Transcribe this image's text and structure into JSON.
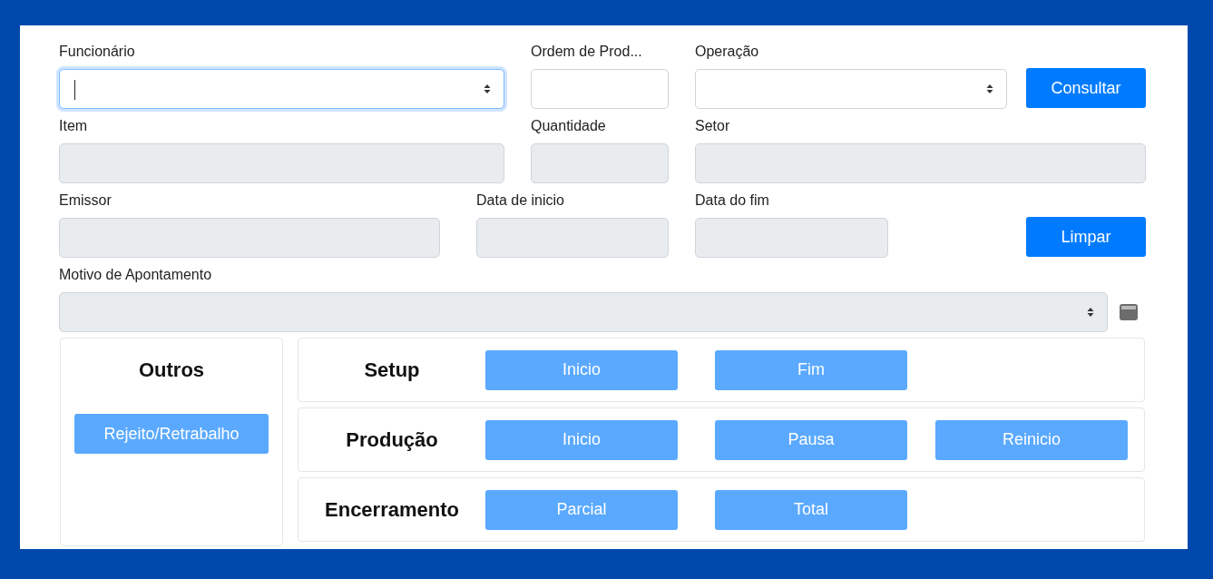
{
  "form": {
    "rows": [
      [
        {
          "kind": "select",
          "label": "Funcionário",
          "disabled": false,
          "focused": true
        },
        {
          "kind": "input",
          "label": "Ordem de Prod...",
          "disabled": false,
          "focused": false
        },
        {
          "kind": "select",
          "label": "Operação",
          "disabled": false,
          "focused": false
        },
        {
          "kind": "button",
          "label": "Consultar",
          "disabled": false
        }
      ],
      [
        {
          "kind": "input",
          "label": "Item",
          "disabled": true,
          "focused": false
        },
        {
          "kind": "input",
          "label": "Quantidade",
          "disabled": true,
          "focused": false
        },
        {
          "kind": "input",
          "label": "Setor",
          "disabled": true,
          "focused": false
        }
      ],
      [
        {
          "kind": "input",
          "label": "Emissor",
          "disabled": true,
          "focused": false
        },
        {
          "kind": "input",
          "label": "Data de inicio",
          "disabled": true,
          "focused": false
        },
        {
          "kind": "input",
          "label": "Data do fim",
          "disabled": true,
          "focused": false
        },
        {
          "kind": "button",
          "label": "Limpar",
          "disabled": false
        }
      ],
      [
        {
          "kind": "select",
          "label": "Motivo de Apontamento",
          "disabled": true,
          "focused": false
        },
        {
          "kind": "icon"
        }
      ]
    ]
  },
  "outros": {
    "title": "Outros",
    "buttons": [
      {
        "label": "Rejeito/Retrabalho",
        "disabled": true
      }
    ]
  },
  "stages": [
    {
      "title": "Setup",
      "buttons": [
        {
          "label": "Inicio",
          "disabled": true
        },
        {
          "label": "Fim",
          "disabled": true
        }
      ]
    },
    {
      "title": "Produção",
      "buttons": [
        {
          "label": "Inicio",
          "disabled": true
        },
        {
          "label": "Pausa",
          "disabled": true
        },
        {
          "label": "Reinicio",
          "disabled": true
        }
      ]
    },
    {
      "title": "Encerramento",
      "buttons": [
        {
          "label": "Parcial",
          "disabled": true
        },
        {
          "label": "Total",
          "disabled": true
        }
      ]
    }
  ]
}
